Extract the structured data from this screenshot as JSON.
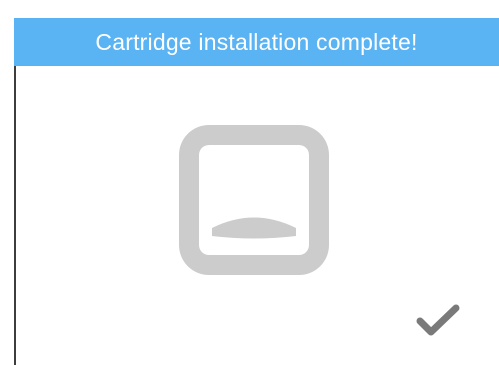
{
  "header": {
    "title": "Cartridge installation complete!",
    "background_color": "#5ab3f3",
    "text_color": "#ffffff"
  },
  "main": {
    "illustration_icon": "cartridge-slot-icon",
    "illustration_color": "#cccccc"
  },
  "actions": {
    "confirm_icon": "checkmark-icon",
    "confirm_color": "#7a7a7a"
  }
}
